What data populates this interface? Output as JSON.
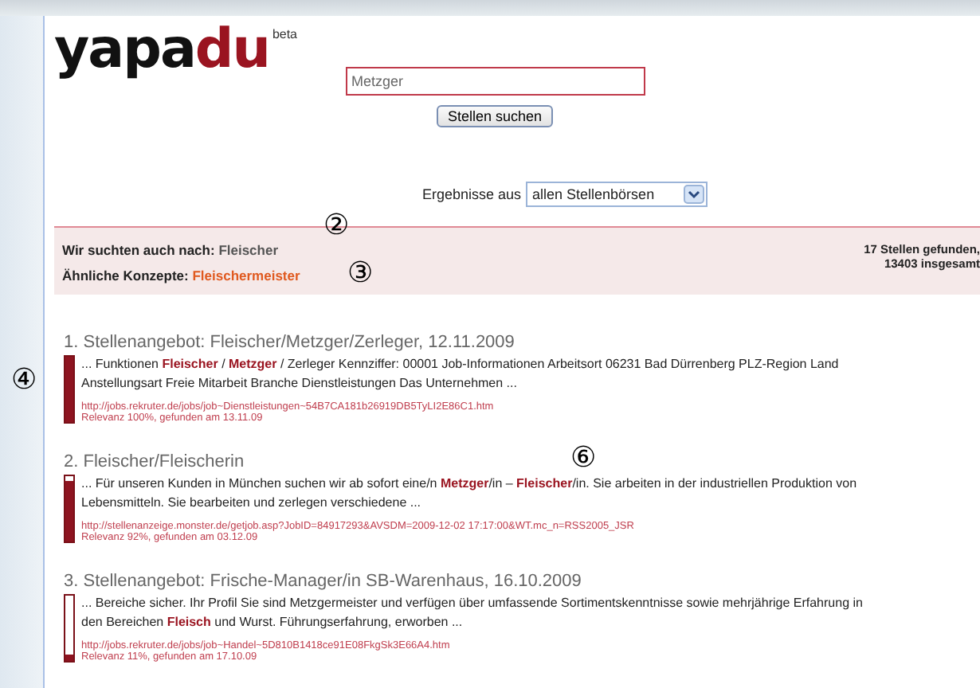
{
  "logo": {
    "text_dark": "yapa",
    "text_red": "du",
    "badge": "beta"
  },
  "search": {
    "value": "Metzger",
    "button": "Stellen suchen"
  },
  "source": {
    "label": "Ergebnisse aus",
    "value": "allen Stellenbörsen"
  },
  "info": {
    "also_label": "Wir suchten auch nach:",
    "also_value": "Fleischer",
    "also_callout": "②",
    "concepts_label": "Ähnliche Konzepte:",
    "concepts_value": "Fleischermeister",
    "concepts_callout": "③",
    "count_line1": "17 Stellen gefunden,",
    "count_line2": "13403 insgesamt"
  },
  "results": [
    {
      "title": "1. Stellenangebot: Fleischer/Metzger/Zerleger, 12.11.2009",
      "snippet": "... Funktionen **Fleischer** / **Metzger** / Zerleger Kennziffer: 00001 Job-Informationen Arbeitsort 06231 Bad Dürrenberg PLZ-Region Land Anstellungsart Freie Mitarbeit Branche Dienstleistungen Das Unternehmen ...",
      "url": "http://jobs.rekruter.de/jobs/job~Dienstleistungen~54B7CA181b26919DB5TyLI2E86C1.htm",
      "relevance": "Relevanz 100%, gefunden am 13.11.09",
      "level": 1.0,
      "side_callout": "④"
    },
    {
      "title": "2. Fleischer/Fleischerin",
      "title_callout": "⑥",
      "snippet": "... Für unseren Kunden in München suchen wir ab sofort eine/n **Metzger**/in – **Fleischer**/in. Sie arbeiten in der industriellen Produktion von Lebensmitteln. Sie bearbeiten und zerlegen verschiedene ...",
      "url": "http://stellenanzeige.monster.de/getjob.asp?JobID=84917293&AVSDM=2009-12-02 17:17:00&WT.mc_n=RSS2005_JSR",
      "relevance": "Relevanz 92%, gefunden am 03.12.09",
      "level": 0.92
    },
    {
      "title": "3. Stellenangebot: Frische-Manager/in SB-Warenhaus, 16.10.2009",
      "snippet": "... Bereiche sicher. Ihr Profil Sie sind Metzgermeister und verfügen über umfassende Sortimentskenntnisse sowie mehrjährige Erfahrung in den Bereichen **Fleisch** und Wurst. Führungserfahrung, erworben ...",
      "url": "http://jobs.rekruter.de/jobs/job~Handel~5D810B1418ce91E08FkgSk3E66A4.htm",
      "relevance": "Relevanz 11%, gefunden am 17.10.09",
      "level": 0.11
    }
  ]
}
